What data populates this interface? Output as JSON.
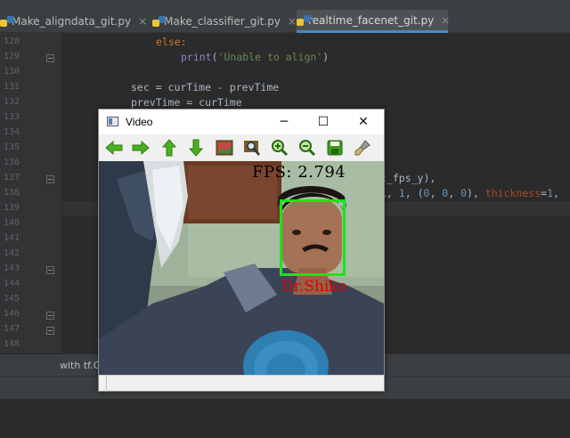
{
  "tabs": [
    {
      "label": "Make_aligndata_git.py",
      "close": "×"
    },
    {
      "label": "Make_classifier_git.py",
      "close": "×"
    },
    {
      "label": "realtime_facenet_git.py",
      "close": "×"
    }
  ],
  "line_numbers": [
    "128",
    "129",
    "130",
    "131",
    "132",
    "133",
    "134",
    "135",
    "136",
    "137",
    "138",
    "139",
    "140",
    "141",
    "142",
    "143",
    "144",
    "145",
    "146",
    "147",
    "148"
  ],
  "code": {
    "l128": "else:",
    "l129_fn": "print",
    "l129_str": "'Unable to align'",
    "l131": "sec = curTime - prevTime",
    "l132": "prevTime = curTime",
    "l137_tail": "t_fps_y),",
    "l138_mid": "L, ",
    "l138_n1": "1",
    "l138_p1": ", (",
    "l138_n2": "0",
    "l138_c1": ", ",
    "l138_n3": "0",
    "l138_c2": ", ",
    "l138_n4": "0",
    "l138_p2": "), ",
    "l138_kw": "thickness",
    "l138_eq": "=",
    "l138_n5": "1",
    "l138_end": ","
  },
  "bottom": {
    "with_label": "with tf.G"
  },
  "video_window": {
    "title": "Video",
    "minimize": "─",
    "maximize": "☐",
    "close": "✕",
    "toolbar_icons": [
      "arrow-left-icon",
      "arrow-right-icon",
      "arrow-up-icon",
      "arrow-down-icon",
      "image-icon",
      "zoom-fit-icon",
      "zoom-in-icon",
      "zoom-out-icon",
      "save-icon",
      "brush-icon"
    ],
    "fps_text": "FPS: 2.794",
    "face_label": "Dr.Shiko"
  },
  "colors": {
    "editor_bg": "#2b2b2b",
    "gutter_bg": "#313335",
    "keyword": "#cc7832",
    "string": "#6a8759",
    "number": "#6897bb",
    "face_box": "#19e619",
    "face_label": "#e00000"
  }
}
